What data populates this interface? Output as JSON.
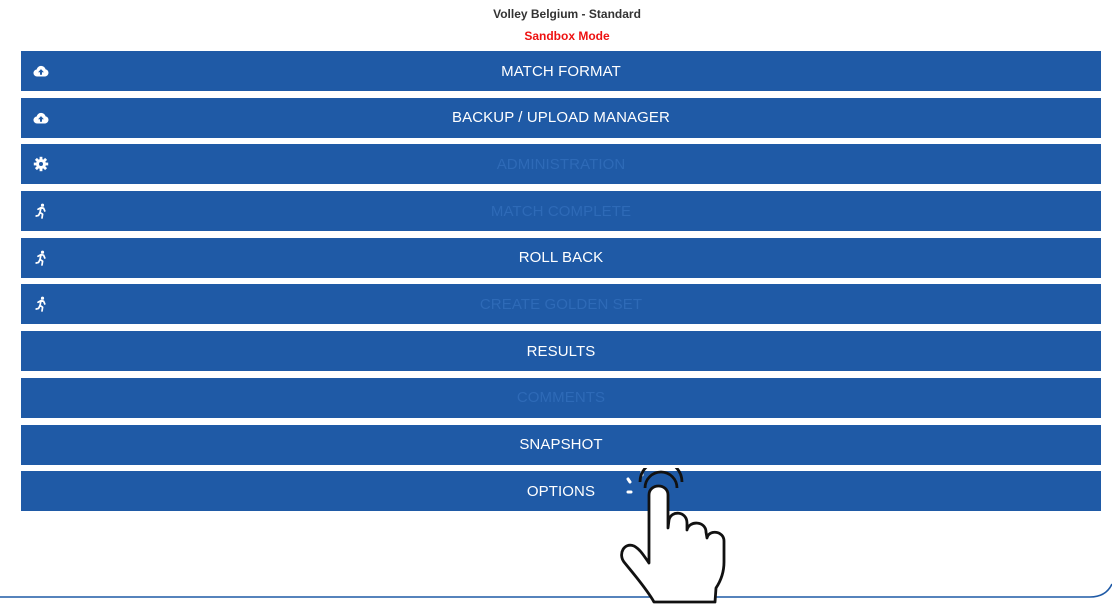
{
  "header": {
    "app_title": "Volley Belgium - Standard",
    "mode_label": "Sandbox Mode"
  },
  "menu": {
    "items": [
      {
        "label": "MATCH FORMAT",
        "icon": "cloud-upload-icon",
        "enabled": true
      },
      {
        "label": "BACKUP / UPLOAD MANAGER",
        "icon": "cloud-upload-icon",
        "enabled": true
      },
      {
        "label": "ADMINISTRATION",
        "icon": "gear-icon",
        "enabled": false
      },
      {
        "label": "MATCH COMPLETE",
        "icon": "running-person-icon",
        "enabled": false
      },
      {
        "label": "ROLL BACK",
        "icon": "running-person-icon",
        "enabled": true
      },
      {
        "label": "CREATE GOLDEN SET",
        "icon": "running-person-icon",
        "enabled": false
      },
      {
        "label": "RESULTS",
        "icon": "",
        "enabled": true
      },
      {
        "label": "COMMENTS",
        "icon": "",
        "enabled": false
      },
      {
        "label": "SNAPSHOT",
        "icon": "",
        "enabled": true
      },
      {
        "label": "OPTIONS",
        "icon": "",
        "enabled": true
      }
    ]
  },
  "colors": {
    "button_bg": "#1f5aa6",
    "button_text": "#ffffff",
    "disabled_text": "#2e6ab7",
    "mode_label": "#ee1111",
    "title_text": "#333333"
  },
  "overlay": {
    "pointer_icon": "tap-hand-icon"
  }
}
